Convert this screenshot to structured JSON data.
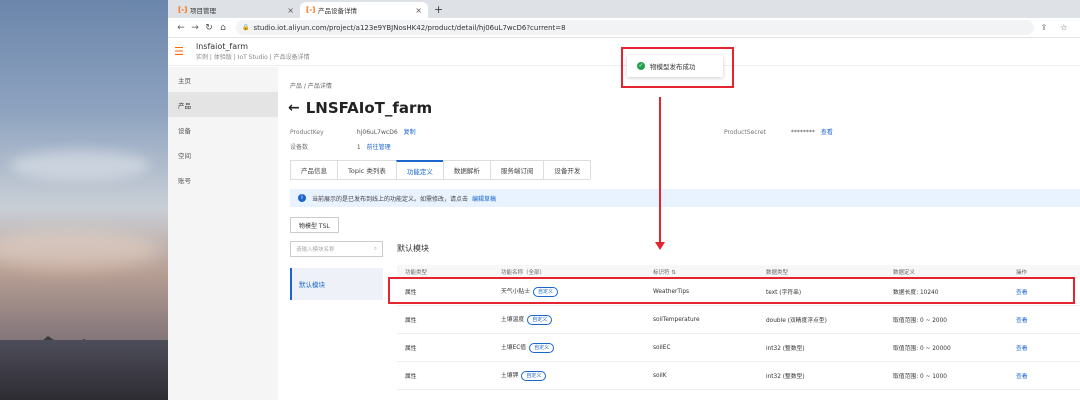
{
  "browser": {
    "tabs": [
      {
        "label": "项目管理",
        "active": false
      },
      {
        "label": "产品设备详情",
        "active": true
      }
    ],
    "new_tab": "+",
    "url": "studio.iot.aliyun.com/project/a123e9YBJNosHK42/product/detail/hj06uL7wcD6?current=8"
  },
  "header": {
    "app_name": "lnsfaiot_farm",
    "breadcrumb": "实例 | 体验版 | IoT Studio | 产品设备详情"
  },
  "sidebar": {
    "items": [
      {
        "label": "主页",
        "active": false
      },
      {
        "label": "产品",
        "active": true
      },
      {
        "label": "设备",
        "active": false
      },
      {
        "label": "空间",
        "active": false
      },
      {
        "label": "账号",
        "active": false
      }
    ]
  },
  "main": {
    "breadcrumb": "产品  /  产品详情",
    "title": "LNSFAIoT_farm",
    "product_key_label": "ProductKey",
    "product_key_value": "hj06uL7wcD6",
    "copy_link": "复制",
    "device_count_label": "设备数",
    "device_count_value": "1",
    "manage_link": "前往管理",
    "secret_label": "ProductSecret",
    "secret_value": "********",
    "view_link": "查看",
    "tabs": [
      "产品信息",
      "Topic 类列表",
      "功能定义",
      "数据解析",
      "服务端订阅",
      "设备开发"
    ],
    "active_tab": 2,
    "notice_text": "当前展示的是已发布到线上的功能定义。如需修改，请点击",
    "notice_link": "编辑草稿",
    "tsl_button": "物模型 TSL",
    "module_search_placeholder": "请输入模块名称",
    "module_item": "默认模块",
    "section_title": "默认模块",
    "table_headers": [
      "功能类型",
      "功能名称（全部）",
      "标识符 ⇅",
      "数据类型",
      "数据定义",
      "操作"
    ],
    "rows": [
      {
        "type": "属性",
        "name": "天气小贴士",
        "tag": "自定义",
        "id": "WeatherTips",
        "dtype": "text (字符串)",
        "def": "数据长度: 10240",
        "op": "查看"
      },
      {
        "type": "属性",
        "name": "土壤温度",
        "tag": "自定义",
        "id": "soilTemperature",
        "dtype": "double (双精度浮点型)",
        "def": "取值范围: 0 ~ 2000",
        "op": "查看"
      },
      {
        "type": "属性",
        "name": "土壤EC值",
        "tag": "自定义",
        "id": "soilEC",
        "dtype": "int32 (整数型)",
        "def": "取值范围: 0 ~ 20000",
        "op": "查看"
      },
      {
        "type": "属性",
        "name": "土壤钾",
        "tag": "自定义",
        "id": "soilK",
        "dtype": "int32 (整数型)",
        "def": "取值范围: 0 ~ 1000",
        "op": "查看"
      }
    ]
  },
  "toast": {
    "message": "物模型发布成功"
  },
  "colors": {
    "accent": "#1a66cc",
    "annotation": "#e4252f",
    "success": "#22a04b",
    "brand": "#ff6a00"
  }
}
